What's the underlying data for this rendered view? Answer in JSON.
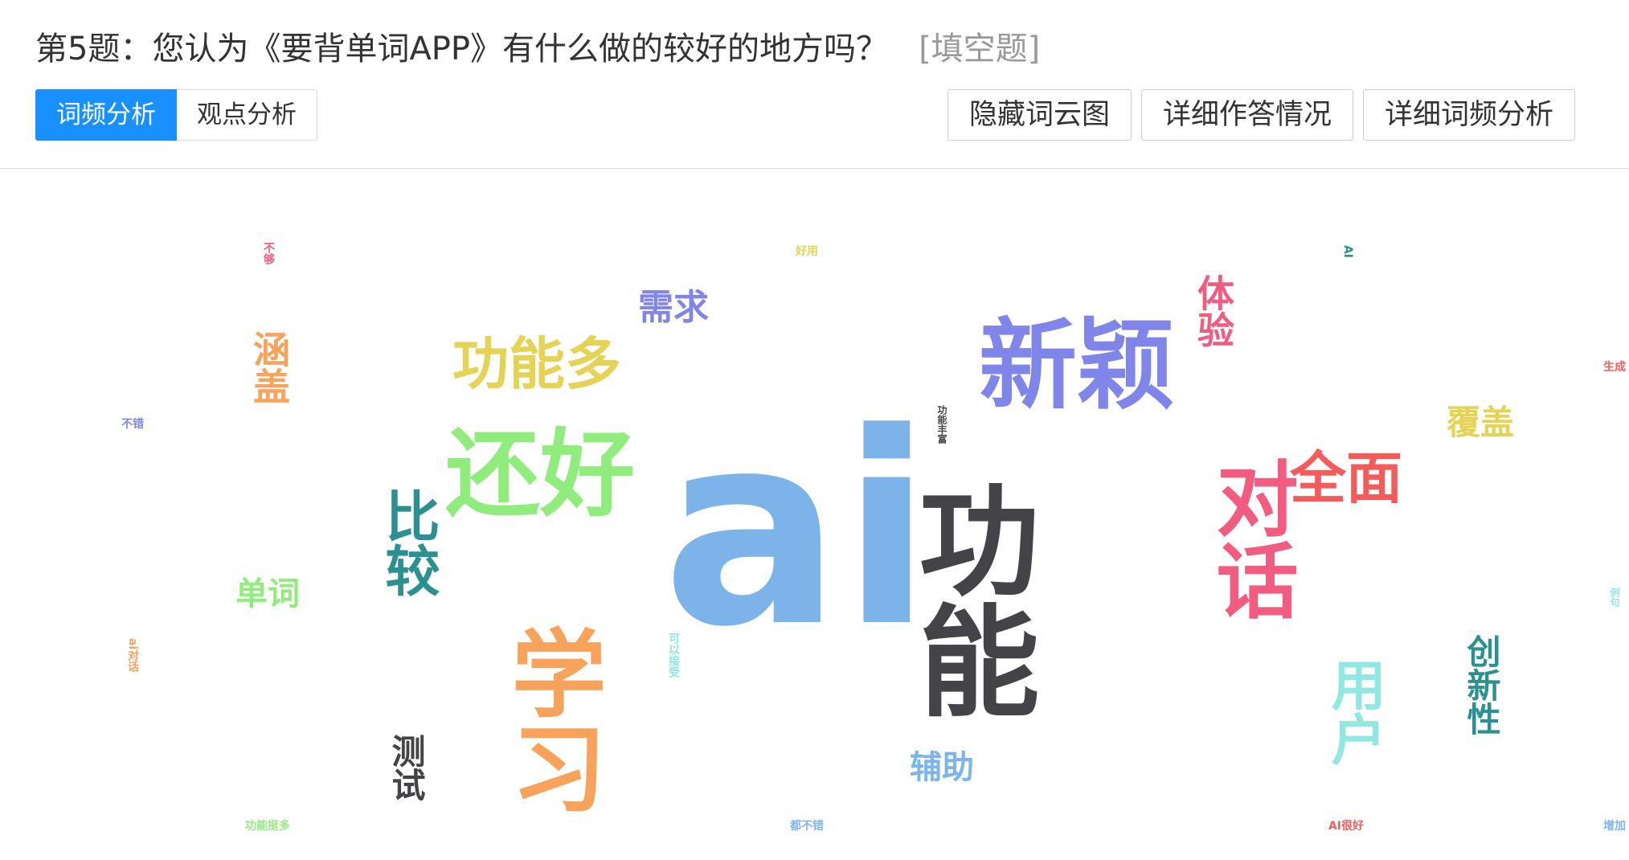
{
  "question": {
    "title": "第5题：您认为《要背单词APP》有什么做的较好的地方吗？",
    "type": "[填空题]"
  },
  "tabs": [
    {
      "label": "词频分析",
      "active": true
    },
    {
      "label": "观点分析",
      "active": false
    }
  ],
  "actions": {
    "hide_cloud": "隐藏词云图",
    "detail_answers": "详细作答情况",
    "detail_frequency": "详细词频分析"
  },
  "colors": {
    "accent": "#1890ff"
  },
  "word_cloud": {
    "words": [
      {
        "text": "ai",
        "color": "#7cb4ea"
      },
      {
        "text": "功能",
        "color": "#434348"
      },
      {
        "text": "新颖",
        "color": "#8085e9"
      },
      {
        "text": "还好",
        "color": "#90ed7d"
      },
      {
        "text": "学习",
        "color": "#f7a35c"
      },
      {
        "text": "对话",
        "color": "#f15c80"
      },
      {
        "text": "功能多",
        "color": "#e4d354"
      },
      {
        "text": "比较",
        "color": "#2b908f"
      },
      {
        "text": "全面",
        "color": "#f45b5b"
      },
      {
        "text": "用户",
        "color": "#91e8e1"
      },
      {
        "text": "体验",
        "color": "#f15c80"
      },
      {
        "text": "需求",
        "color": "#8085e9"
      },
      {
        "text": "涵盖",
        "color": "#f7a35c"
      },
      {
        "text": "覆盖",
        "color": "#e4d354"
      },
      {
        "text": "单词",
        "color": "#90ed7d"
      },
      {
        "text": "创新性",
        "color": "#2b908f"
      },
      {
        "text": "测试",
        "color": "#434348"
      },
      {
        "text": "辅助",
        "color": "#7cb5ec"
      },
      {
        "text": "不够",
        "color": "#f15c80"
      },
      {
        "text": "好用",
        "color": "#e4d354"
      },
      {
        "text": "AI",
        "color": "#2b908f"
      },
      {
        "text": "生成",
        "color": "#f45b5b"
      },
      {
        "text": "不错",
        "color": "#8085e9"
      },
      {
        "text": "功能丰富",
        "color": "#434348"
      },
      {
        "text": "ai对话",
        "color": "#f7a35c"
      },
      {
        "text": "可以接受",
        "color": "#91e8e1"
      },
      {
        "text": "例句",
        "color": "#91e8e1"
      },
      {
        "text": "功能挺多",
        "color": "#90ed7d"
      },
      {
        "text": "都不错",
        "color": "#7cb5ec"
      },
      {
        "text": "AI很好",
        "color": "#f45b5b"
      },
      {
        "text": "增加",
        "color": "#7cb5ec"
      }
    ]
  }
}
